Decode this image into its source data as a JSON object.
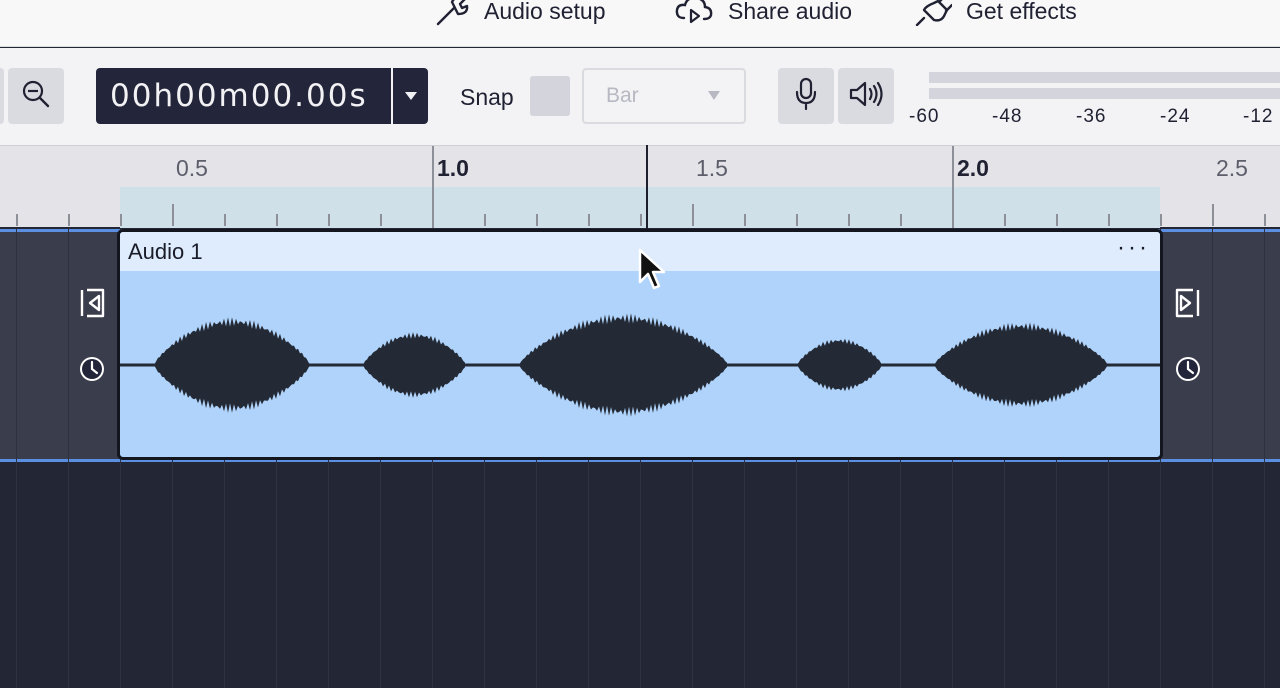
{
  "header": {
    "audio_setup": "Audio setup",
    "share_audio": "Share audio",
    "get_effects": "Get effects"
  },
  "toolbar": {
    "time": "00h00m00.00s",
    "snap_label": "Snap",
    "snap_select_value": "Bar",
    "meter_ticks": [
      "-60",
      "-48",
      "-36",
      "-24",
      "-12"
    ]
  },
  "ruler": {
    "labels": [
      {
        "text": "0.5",
        "major": false
      },
      {
        "text": "1.0",
        "major": true
      },
      {
        "text": "1.5",
        "major": false
      },
      {
        "text": "2.0",
        "major": true
      },
      {
        "text": "2.5",
        "major": false
      }
    ]
  },
  "clip": {
    "title": "Audio 1",
    "menu": "···"
  },
  "colors": {
    "accent": "#5a8fe2",
    "clip_body": "#b0d3fb",
    "clip_header": "#deecfd",
    "waveform": "#232a35",
    "dark_bg": "#232634",
    "track_bg": "#3a3d4b"
  },
  "icons": {
    "audio_setup": "wrench-icon",
    "share_audio": "cloud-share-icon",
    "get_effects": "plug-icon",
    "zoom_out": "zoom-out-icon",
    "record_input": "microphone-icon",
    "playback_output": "speaker-icon",
    "clip_trim_left": "trim-left-icon",
    "clip_trim_right": "trim-right-icon",
    "clip_stretch_left": "clock-icon",
    "clip_stretch_right": "clock-icon"
  }
}
